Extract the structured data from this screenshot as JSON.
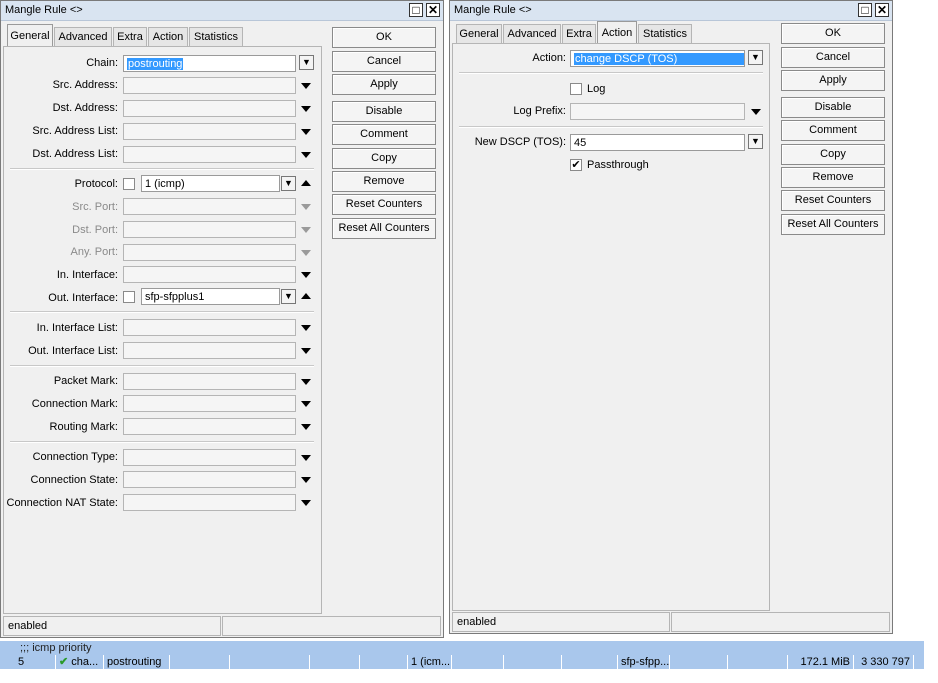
{
  "left_window": {
    "title": "Mangle Rule <>",
    "tabs": [
      "General",
      "Advanced",
      "Extra",
      "Action",
      "Statistics"
    ],
    "active_tab": "General",
    "fields": {
      "chain": {
        "label": "Chain:",
        "value": "postrouting"
      },
      "src_address": {
        "label": "Src. Address:",
        "value": ""
      },
      "dst_address": {
        "label": "Dst. Address:",
        "value": ""
      },
      "src_address_list": {
        "label": "Src. Address List:",
        "value": ""
      },
      "dst_address_list": {
        "label": "Dst. Address List:",
        "value": ""
      },
      "protocol": {
        "label": "Protocol:",
        "value": "1 (icmp)"
      },
      "src_port": {
        "label": "Src. Port:",
        "value": ""
      },
      "dst_port": {
        "label": "Dst. Port:",
        "value": ""
      },
      "any_port": {
        "label": "Any. Port:",
        "value": ""
      },
      "in_interface": {
        "label": "In. Interface:",
        "value": ""
      },
      "out_interface": {
        "label": "Out. Interface:",
        "value": "sfp-sfpplus1"
      },
      "in_interface_list": {
        "label": "In. Interface List:",
        "value": ""
      },
      "out_interface_list": {
        "label": "Out. Interface List:",
        "value": ""
      },
      "packet_mark": {
        "label": "Packet Mark:",
        "value": ""
      },
      "connection_mark": {
        "label": "Connection Mark:",
        "value": ""
      },
      "routing_mark": {
        "label": "Routing Mark:",
        "value": ""
      },
      "connection_type": {
        "label": "Connection Type:",
        "value": ""
      },
      "connection_state": {
        "label": "Connection State:",
        "value": ""
      },
      "connection_nat_state": {
        "label": "Connection NAT State:",
        "value": ""
      }
    },
    "buttons": [
      "OK",
      "Cancel",
      "Apply",
      "Disable",
      "Comment",
      "Copy",
      "Remove",
      "Reset Counters",
      "Reset All Counters"
    ],
    "status": "enabled"
  },
  "right_window": {
    "title": "Mangle Rule <>",
    "tabs": [
      "General",
      "Advanced",
      "Extra",
      "Action",
      "Statistics"
    ],
    "active_tab": "Action",
    "fields": {
      "action": {
        "label": "Action:",
        "value": "change DSCP (TOS)"
      },
      "log": {
        "label": "Log",
        "checked": false
      },
      "log_prefix": {
        "label": "Log Prefix:",
        "value": ""
      },
      "new_dscp": {
        "label": "New DSCP (TOS):",
        "value": "45"
      },
      "passthrough": {
        "label": "Passthrough",
        "checked": true
      }
    },
    "buttons": [
      "OK",
      "Cancel",
      "Apply",
      "Disable",
      "Comment",
      "Copy",
      "Remove",
      "Reset Counters",
      "Reset All Counters"
    ],
    "status": "enabled"
  },
  "rule_list": {
    "comment": ";;; icmp priority",
    "row": {
      "number": "5",
      "action": "cha...",
      "chain": "postrouting",
      "protocol": "1 (icm...",
      "out_interface": "sfp-sfpp...",
      "bytes": "172.1 MiB",
      "packets": "3 330 797"
    }
  },
  "colors": {
    "list_bg": "#a9c7ec",
    "selection": "#3399ff",
    "title_bg": "#d9e4f1"
  }
}
